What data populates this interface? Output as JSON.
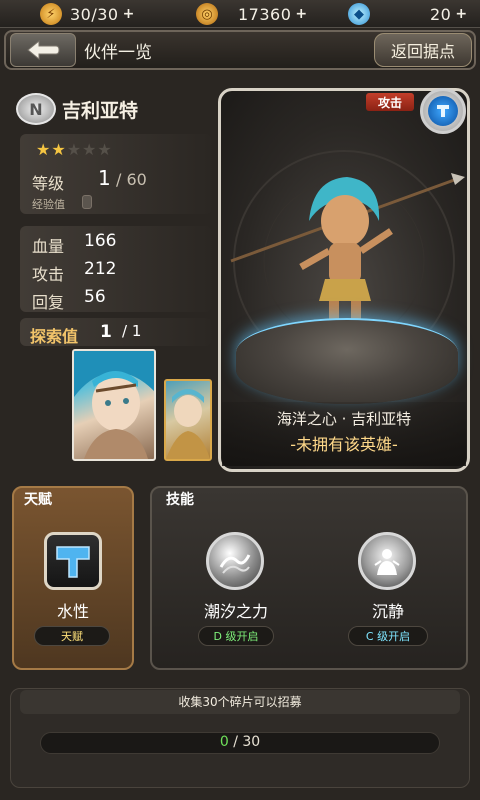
{
  "resources": [
    {
      "icon": "stamina-icon",
      "value": "30/30",
      "plus": "+"
    },
    {
      "icon": "gold-coin-icon",
      "value": "17360",
      "plus": "+"
    },
    {
      "icon": "diamond-icon",
      "value": "20",
      "plus": "+"
    }
  ],
  "header": {
    "title": "伙伴一览",
    "home_button": "返回据点"
  },
  "hero": {
    "rank_badge": "N",
    "name": "吉利亚特",
    "stars_filled": 2,
    "stars_total": 5,
    "level_label": "等级",
    "level": "1",
    "level_max": "/ 60",
    "exp_label": "经验值",
    "stats": [
      {
        "label": "血量",
        "value": "166"
      },
      {
        "label": "攻击",
        "value": "212"
      },
      {
        "label": "回复",
        "value": "56"
      }
    ],
    "explore_label": "探索值",
    "explore_value": "1",
    "explore_max": "/ 1"
  },
  "card": {
    "type_tag": "攻击",
    "element": "water-element-icon",
    "title": "海洋之心 · 吉利亚特",
    "status": "-未拥有该英雄-"
  },
  "talent": {
    "header": "天赋",
    "name": "水性",
    "tag": "天赋",
    "icon": "hammer-icon"
  },
  "skills": {
    "header": "技能",
    "items": [
      {
        "name": "潮汐之力",
        "unlock": "D 级开启",
        "icon": "tide-skill-icon"
      },
      {
        "name": "沉静",
        "unlock": "C 级开启",
        "icon": "calm-skill-icon"
      }
    ]
  },
  "recruit": {
    "label": "收集30个碎片可以招募",
    "current": "0",
    "max": "/ 30",
    "progress": 0
  },
  "colors": {
    "gold_accent": "#f2c46a",
    "progress_green": "#6fe05a",
    "unlock_yellow": "#ffe27a",
    "unlock_green": "#7ef07a",
    "unlock_cyan": "#7fe6ff"
  }
}
